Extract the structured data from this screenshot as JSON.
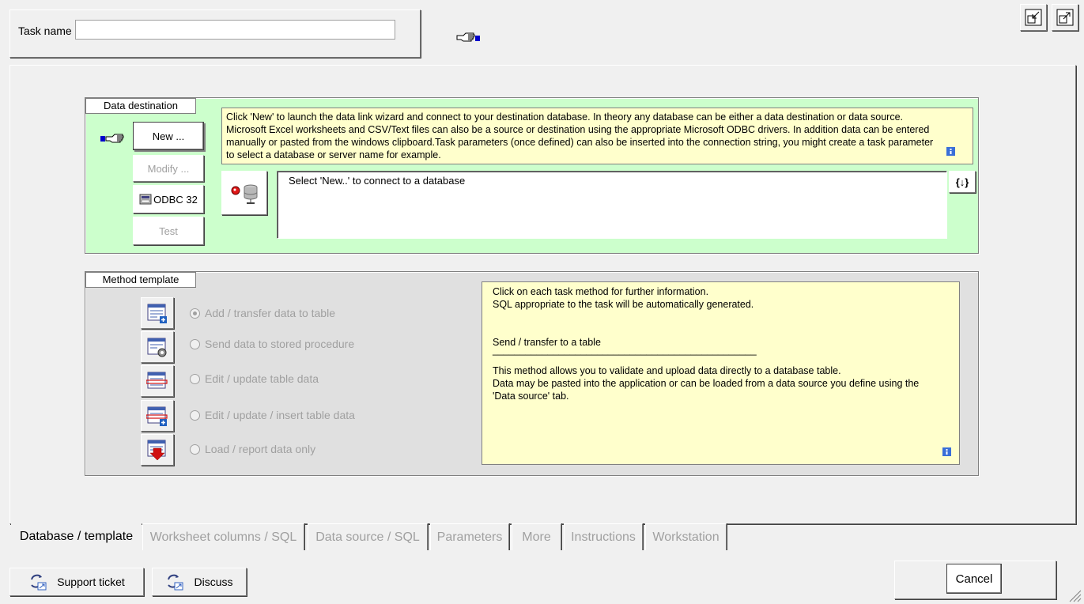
{
  "task": {
    "label": "Task name",
    "value": ""
  },
  "destination": {
    "group_label": "Data destination",
    "buttons": {
      "new": "New ...",
      "modify": "Modify ...",
      "odbc": "ODBC 32",
      "test": "Test"
    },
    "info_lines": [
      "Click 'New' to launch the data link wizard and connect to your destination database.  In theory any database can be either a data destination or data source.",
      "Microsoft Excel worksheets and CSV/Text files can also be a source or destination using the appropriate Microsoft ODBC drivers.   In addition data can be entered",
      "manually or pasted from the windows clipboard.Task parameters (once defined) can also be inserted into the connection string, you might create a task parameter",
      "to select a database or server name for example."
    ],
    "connection_text": "Select 'New..' to connect to a database",
    "param_button": "{↓}"
  },
  "method": {
    "group_label": "Method template",
    "options": [
      {
        "label": "Add / transfer data to table",
        "selected": true
      },
      {
        "label": "Send data to stored procedure",
        "selected": false
      },
      {
        "label": "Edit / update table data",
        "selected": false
      },
      {
        "label": "Edit / update / insert table data",
        "selected": false
      },
      {
        "label": "Load / report data only",
        "selected": false
      }
    ],
    "info": {
      "line1": "Click on each task method for further information.",
      "line2": "SQL appropriate to the task will be automatically generated.",
      "heading": "Send / transfer to a table",
      "rule": "________________________________________________",
      "desc1": "This method allows you to validate and upload data directly to a database table.",
      "desc2": "Data may be pasted into the application or can be loaded from a data source you define using the",
      "desc3": "'Data source' tab."
    }
  },
  "tabs": [
    {
      "label": "Database / template",
      "active": true
    },
    {
      "label": "Worksheet columns / SQL",
      "active": false
    },
    {
      "label": "Data source / SQL",
      "active": false
    },
    {
      "label": "Parameters",
      "active": false
    },
    {
      "label": "More",
      "active": false
    },
    {
      "label": "Instructions",
      "active": false
    },
    {
      "label": "Workstation",
      "active": false
    }
  ],
  "footer": {
    "support": "Support ticket",
    "discuss": "Discuss",
    "cancel": "Cancel"
  },
  "colors": {
    "dest_bg": "#ccffcc",
    "info_bg": "#ffffcc",
    "method_bg": "#e0e0e0"
  }
}
